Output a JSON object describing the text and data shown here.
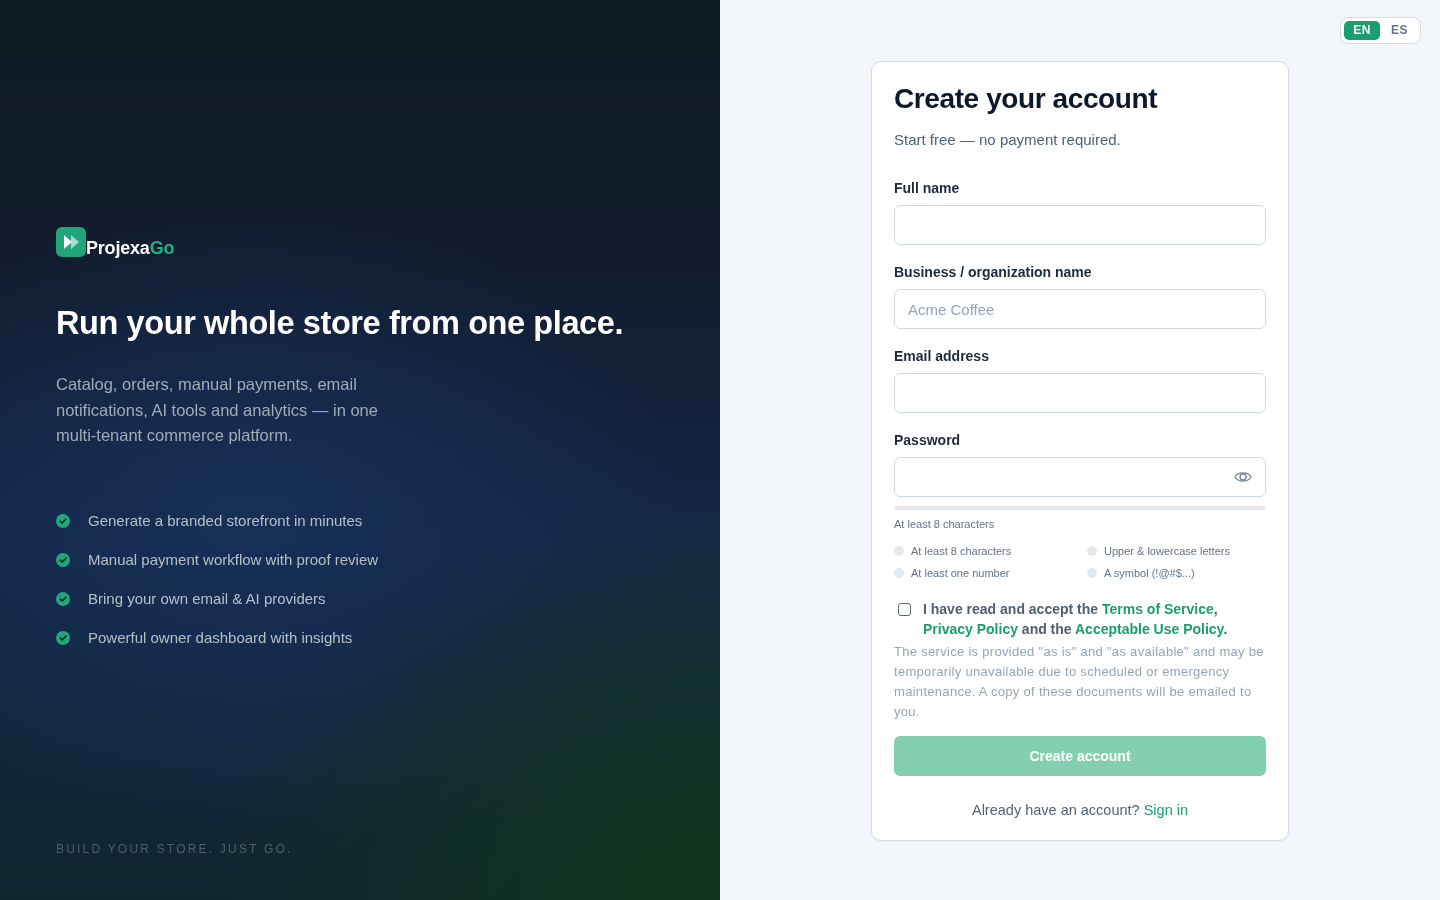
{
  "brand": {
    "name": "Projexa",
    "accent": "Go"
  },
  "hero": {
    "headline": "Run your whole store from one place.",
    "description": "Catalog, orders, manual payments, email notifications, AI tools and analytics — in one multi-tenant commerce platform."
  },
  "features": [
    "Generate a branded storefront in minutes",
    "Manual payment workflow with proof review",
    "Bring your own email & AI providers",
    "Powerful owner dashboard with insights"
  ],
  "tagline": "BUILD YOUR STORE. JUST GO.",
  "language_switch": [
    {
      "label": "EN",
      "selected": true
    },
    {
      "label": "ES",
      "selected": false
    }
  ],
  "form": {
    "title": "Create your account",
    "subtitle": "Start free — no payment required.",
    "fields": [
      {
        "label": "Full name",
        "kind": "text"
      },
      {
        "label": "Business / organization name",
        "kind": "text",
        "placeholder": "Acme Coffee"
      },
      {
        "label": "Email address",
        "kind": "email"
      },
      {
        "label": "Password",
        "kind": "password"
      }
    ],
    "password_strength": {
      "level": 0,
      "hint": "At least 8 characters"
    },
    "requirements": [
      {
        "label": "At least 8 characters",
        "met": false
      },
      {
        "label": "Upper & lowercase letters",
        "met": false
      },
      {
        "label": "At least one number",
        "met": false
      },
      {
        "label": "A symbol (!@#$...)",
        "met": false
      }
    ],
    "terms": {
      "checked": false,
      "parts": [
        {
          "kind": "text",
          "text": "I have read and accept the "
        },
        {
          "kind": "link",
          "text": "Terms of Service"
        },
        {
          "kind": "text",
          "text": ", "
        },
        {
          "kind": "link",
          "text": "Privacy Policy"
        },
        {
          "kind": "text",
          "text": " and the "
        },
        {
          "kind": "link",
          "text": "Acceptable Use Policy"
        },
        {
          "kind": "text",
          "text": "."
        }
      ]
    },
    "disclaimer": "The service is provided \"as is\" and \"as available\" and may be temporarily unavailable due to scheduled or emergency maintenance. A copy of these documents will be emailed to you.",
    "submit": {
      "label": "Create account",
      "disabled": true
    },
    "signin": {
      "prompt": "Already have an account?",
      "link": "Sign in"
    }
  }
}
